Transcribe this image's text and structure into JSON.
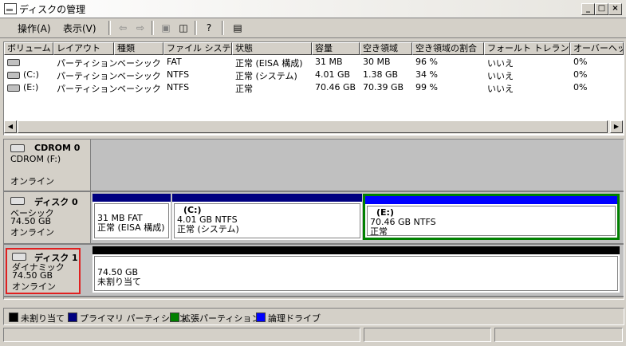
{
  "window": {
    "title": "ディスクの管理"
  },
  "menu": {
    "action": "操作(A)",
    "view": "表示(V)"
  },
  "columns": [
    "ボリューム",
    "レイアウト",
    "種類",
    "ファイル システム",
    "状態",
    "容量",
    "空き領域",
    "空き領域の割合",
    "フォールト トレランス",
    "オーバーヘッド"
  ],
  "volumes": [
    {
      "volume": "",
      "layout": "パーティション",
      "type": "ベーシック",
      "fs": "FAT",
      "status": "正常 (EISA 構成)",
      "capacity": "31 MB",
      "free": "30 MB",
      "pct": "96 %",
      "fault": "いいえ",
      "overhead": "0%"
    },
    {
      "volume": "(C:)",
      "layout": "パーティション",
      "type": "ベーシック",
      "fs": "NTFS",
      "status": "正常 (システム)",
      "capacity": "4.01 GB",
      "free": "1.38 GB",
      "pct": "34 %",
      "fault": "いいえ",
      "overhead": "0%"
    },
    {
      "volume": "(E:)",
      "layout": "パーティション",
      "type": "ベーシック",
      "fs": "NTFS",
      "status": "正常",
      "capacity": "70.46 GB",
      "free": "70.39 GB",
      "pct": "99 %",
      "fault": "いいえ",
      "overhead": "0%"
    }
  ],
  "disks": {
    "cdrom": {
      "name": "CDROM 0",
      "line1": "CDROM (F:)",
      "line2": "",
      "line3": "オンライン"
    },
    "disk0": {
      "name": "ディスク 0",
      "line1": "ベーシック",
      "line2": "74.50 GB",
      "line3": "オンライン",
      "partitions": [
        {
          "label": "",
          "size": "31 MB FAT",
          "status": "正常 (EISA 構成)"
        },
        {
          "label": "(C:)",
          "size": "4.01 GB NTFS",
          "status": "正常 (システム)"
        },
        {
          "label": "(E:)",
          "size": "70.46 GB NTFS",
          "status": "正常"
        }
      ]
    },
    "disk1": {
      "name": "ディスク 1",
      "line1": "ダイナミック",
      "line2": "74.50 GB",
      "line3": "オンライン",
      "partitions": [
        {
          "label": "",
          "size": "74.50 GB",
          "status": "未割り当て"
        }
      ]
    }
  },
  "legend": [
    {
      "label": "未割り当て",
      "color": "#000000"
    },
    {
      "label": "プライマリ パーティション",
      "color": "#000080"
    },
    {
      "label": "拡張パーティション",
      "color": "#008000"
    },
    {
      "label": "論理ドライブ",
      "color": "#0000ff"
    }
  ],
  "colors": {
    "primary": "#000080",
    "logical": "#0000ff",
    "extended": "#008000",
    "unallocated": "#000000",
    "selection": "#e02020"
  }
}
